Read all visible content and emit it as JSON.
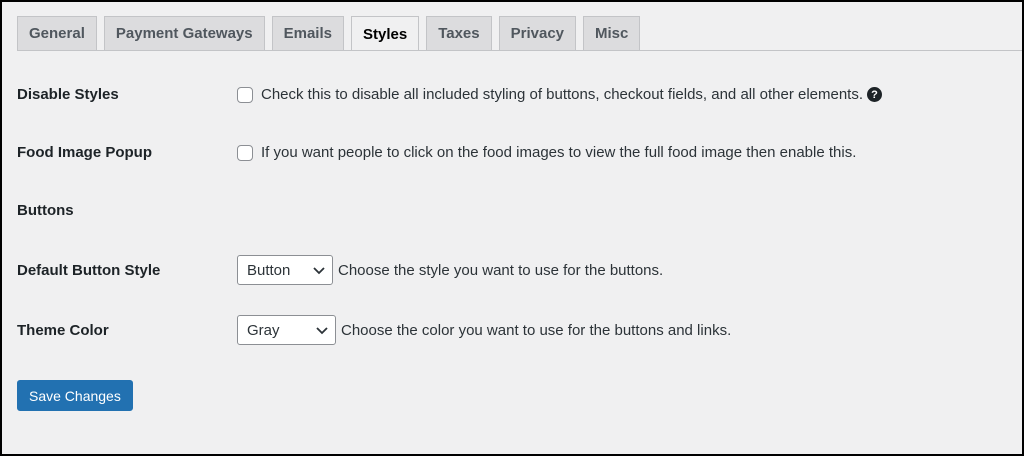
{
  "tabs": [
    {
      "label": "General",
      "active": false
    },
    {
      "label": "Payment Gateways",
      "active": false
    },
    {
      "label": "Emails",
      "active": false
    },
    {
      "label": "Styles",
      "active": true
    },
    {
      "label": "Taxes",
      "active": false
    },
    {
      "label": "Privacy",
      "active": false
    },
    {
      "label": "Misc",
      "active": false
    }
  ],
  "settings": {
    "disable_styles": {
      "label": "Disable Styles",
      "description": "Check this to disable all included styling of buttons, checkout fields, and all other elements.",
      "checked": false,
      "help_icon": "?"
    },
    "food_image_popup": {
      "label": "Food Image Popup",
      "description": "If you want people to click on the food images to view the full food image then enable this.",
      "checked": false
    },
    "buttons_heading": "Buttons",
    "default_button_style": {
      "label": "Default Button Style",
      "selected": "Button",
      "description": "Choose the style you want to use for the buttons."
    },
    "theme_color": {
      "label": "Theme Color",
      "selected": "Gray",
      "description": "Choose the color you want to use for the buttons and links."
    }
  },
  "save_button_label": "Save Changes",
  "colors": {
    "primary": "#2271b1",
    "background": "#f0f0f1",
    "tab_inactive": "#dcdcde"
  }
}
